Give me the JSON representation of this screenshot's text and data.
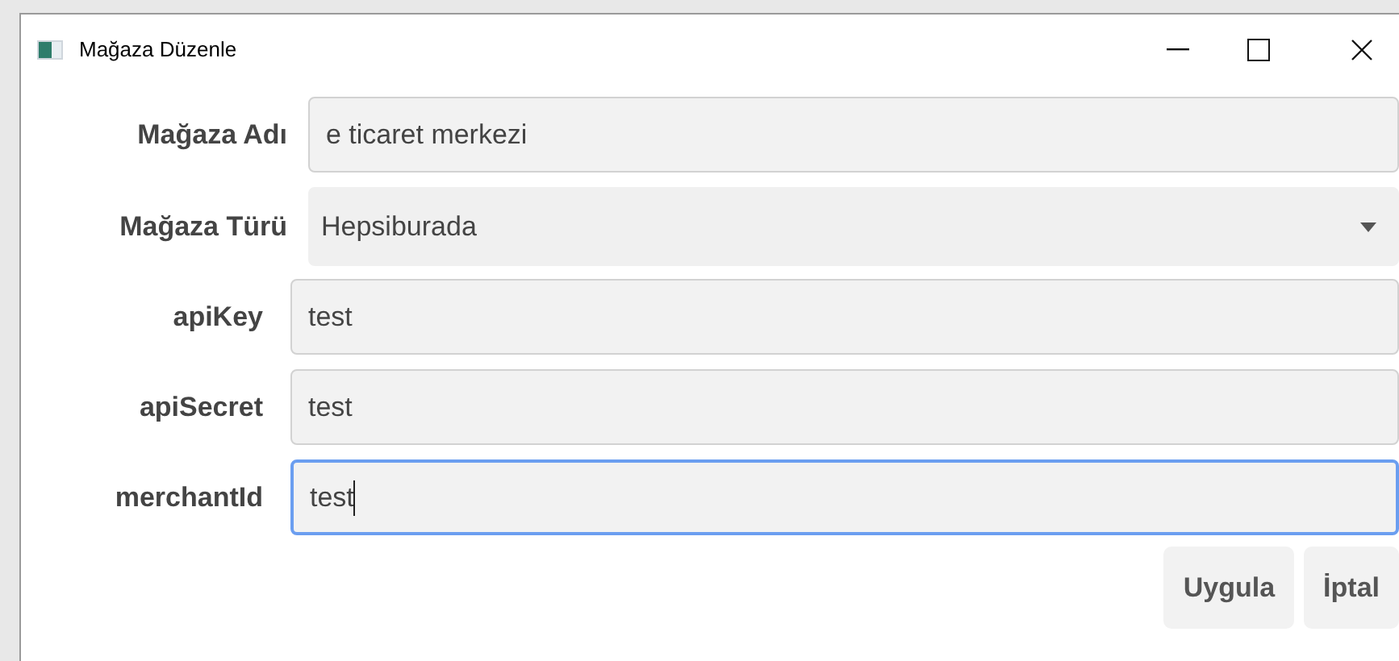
{
  "window": {
    "title": "Mağaza Düzenle"
  },
  "groups": [
    {
      "fields": [
        {
          "label": "Mağaza Adı",
          "kind": "text",
          "value": "e ticaret merkezi",
          "focused": false
        },
        {
          "label": "Mağaza Türü",
          "kind": "dropdown",
          "value": "Hepsiburada",
          "focused": false
        }
      ]
    },
    {
      "fields": [
        {
          "label": "apiKey",
          "kind": "text",
          "value": "test",
          "focused": false
        },
        {
          "label": "apiSecret",
          "kind": "text",
          "value": "test",
          "focused": false
        },
        {
          "label": "merchantId",
          "kind": "text",
          "value": "test",
          "focused": true
        }
      ]
    }
  ],
  "buttons": [
    "Uygula",
    "İptal"
  ]
}
